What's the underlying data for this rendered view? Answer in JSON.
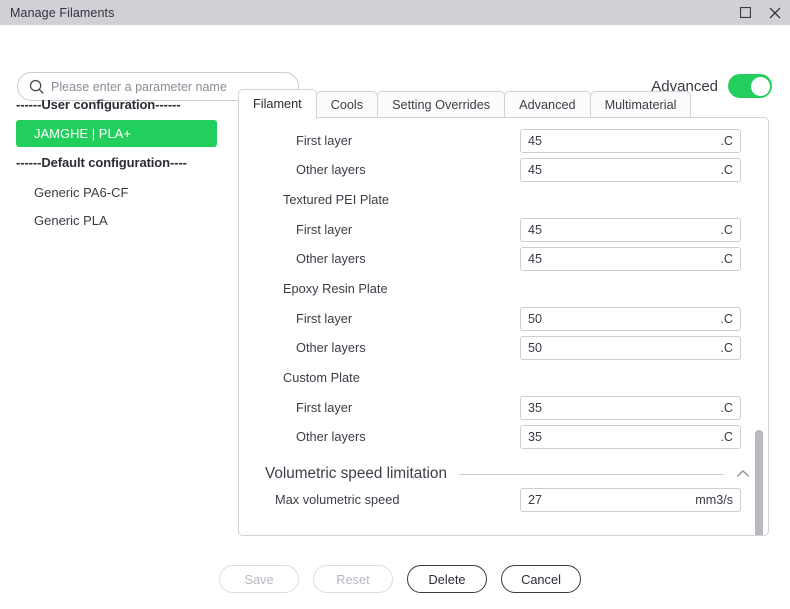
{
  "window": {
    "title": "Manage Filaments",
    "maximize_icon": "maximize-icon",
    "close_icon": "close-icon"
  },
  "search": {
    "icon": "search-icon",
    "value": "",
    "placeholder": "Please enter a parameter name"
  },
  "advanced": {
    "label": "Advanced",
    "enabled": true,
    "accent_color": "#23cf5c"
  },
  "sidebar": {
    "groups": [
      {
        "header": "------User configuration------",
        "items": [
          {
            "label": "JAMGHE | PLA+",
            "selected": true
          }
        ]
      },
      {
        "header": "------Default configuration----",
        "items": [
          {
            "label": "Generic PA6-CF",
            "selected": false
          },
          {
            "label": "Generic PLA",
            "selected": false
          }
        ]
      }
    ]
  },
  "tabs": [
    {
      "label": "Filament",
      "active": true
    },
    {
      "label": "Cools",
      "active": false
    },
    {
      "label": "Setting Overrides",
      "active": false
    },
    {
      "label": "Advanced",
      "active": false
    },
    {
      "label": "Multimaterial",
      "active": false
    }
  ],
  "form": {
    "rows": [
      {
        "kind": "field",
        "label": "First layer",
        "value": "45",
        "unit": ".C"
      },
      {
        "kind": "field",
        "label": "Other layers",
        "value": "45",
        "unit": ".C"
      },
      {
        "kind": "group",
        "label": "Textured PEI Plate"
      },
      {
        "kind": "field",
        "label": "First layer",
        "value": "45",
        "unit": ".C"
      },
      {
        "kind": "field",
        "label": "Other layers",
        "value": "45",
        "unit": ".C"
      },
      {
        "kind": "group",
        "label": "Epoxy Resin Plate"
      },
      {
        "kind": "field",
        "label": "First layer",
        "value": "50",
        "unit": ".C"
      },
      {
        "kind": "field",
        "label": "Other layers",
        "value": "50",
        "unit": ".C"
      },
      {
        "kind": "group",
        "label": "Custom Plate"
      },
      {
        "kind": "field",
        "label": "First layer",
        "value": "35",
        "unit": ".C"
      },
      {
        "kind": "field",
        "label": "Other layers",
        "value": "35",
        "unit": ".C"
      }
    ],
    "section": {
      "title": "Volumetric speed limitation",
      "collapse_icon": "chevron-up-icon",
      "rows": [
        {
          "kind": "field",
          "label": "Max volumetric speed",
          "value": "27",
          "unit": "mm3/s"
        }
      ]
    }
  },
  "footer": {
    "buttons": [
      {
        "label": "Save",
        "enabled": false
      },
      {
        "label": "Reset",
        "enabled": false
      },
      {
        "label": "Delete",
        "enabled": true
      },
      {
        "label": "Cancel",
        "enabled": true
      }
    ]
  }
}
